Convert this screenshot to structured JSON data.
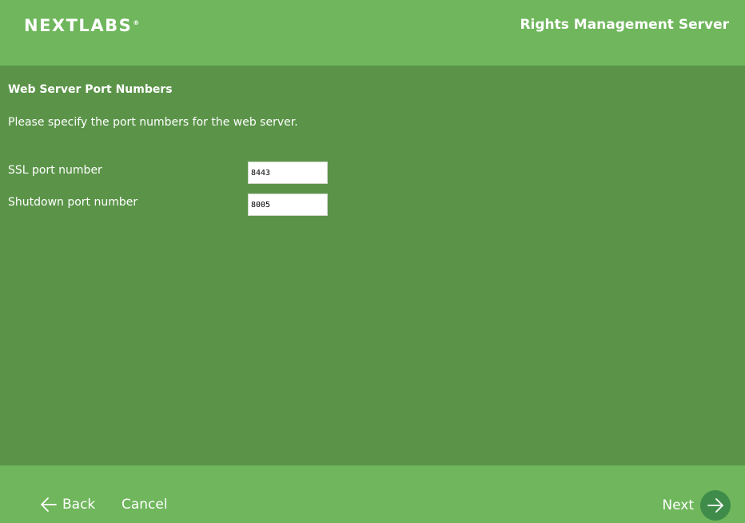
{
  "header": {
    "logo_text": "NEXTLABS",
    "logo_mark": "®",
    "app_title": "Rights Management Server"
  },
  "main": {
    "section_title": "Web Server Port Numbers",
    "description": "Please specify the port numbers for the web server.",
    "fields": [
      {
        "label": "SSL port number",
        "value": "8443"
      },
      {
        "label": "Shutdown port number",
        "value": "8005"
      }
    ]
  },
  "footer": {
    "back_label": "Back",
    "cancel_label": "Cancel",
    "next_label": "Next",
    "back_icon": "arrow-left-icon",
    "next_icon": "arrow-right-icon"
  },
  "colors": {
    "header_bg": "#6fb65c",
    "main_bg": "#5b9449",
    "next_circle": "#3f8c4a"
  }
}
